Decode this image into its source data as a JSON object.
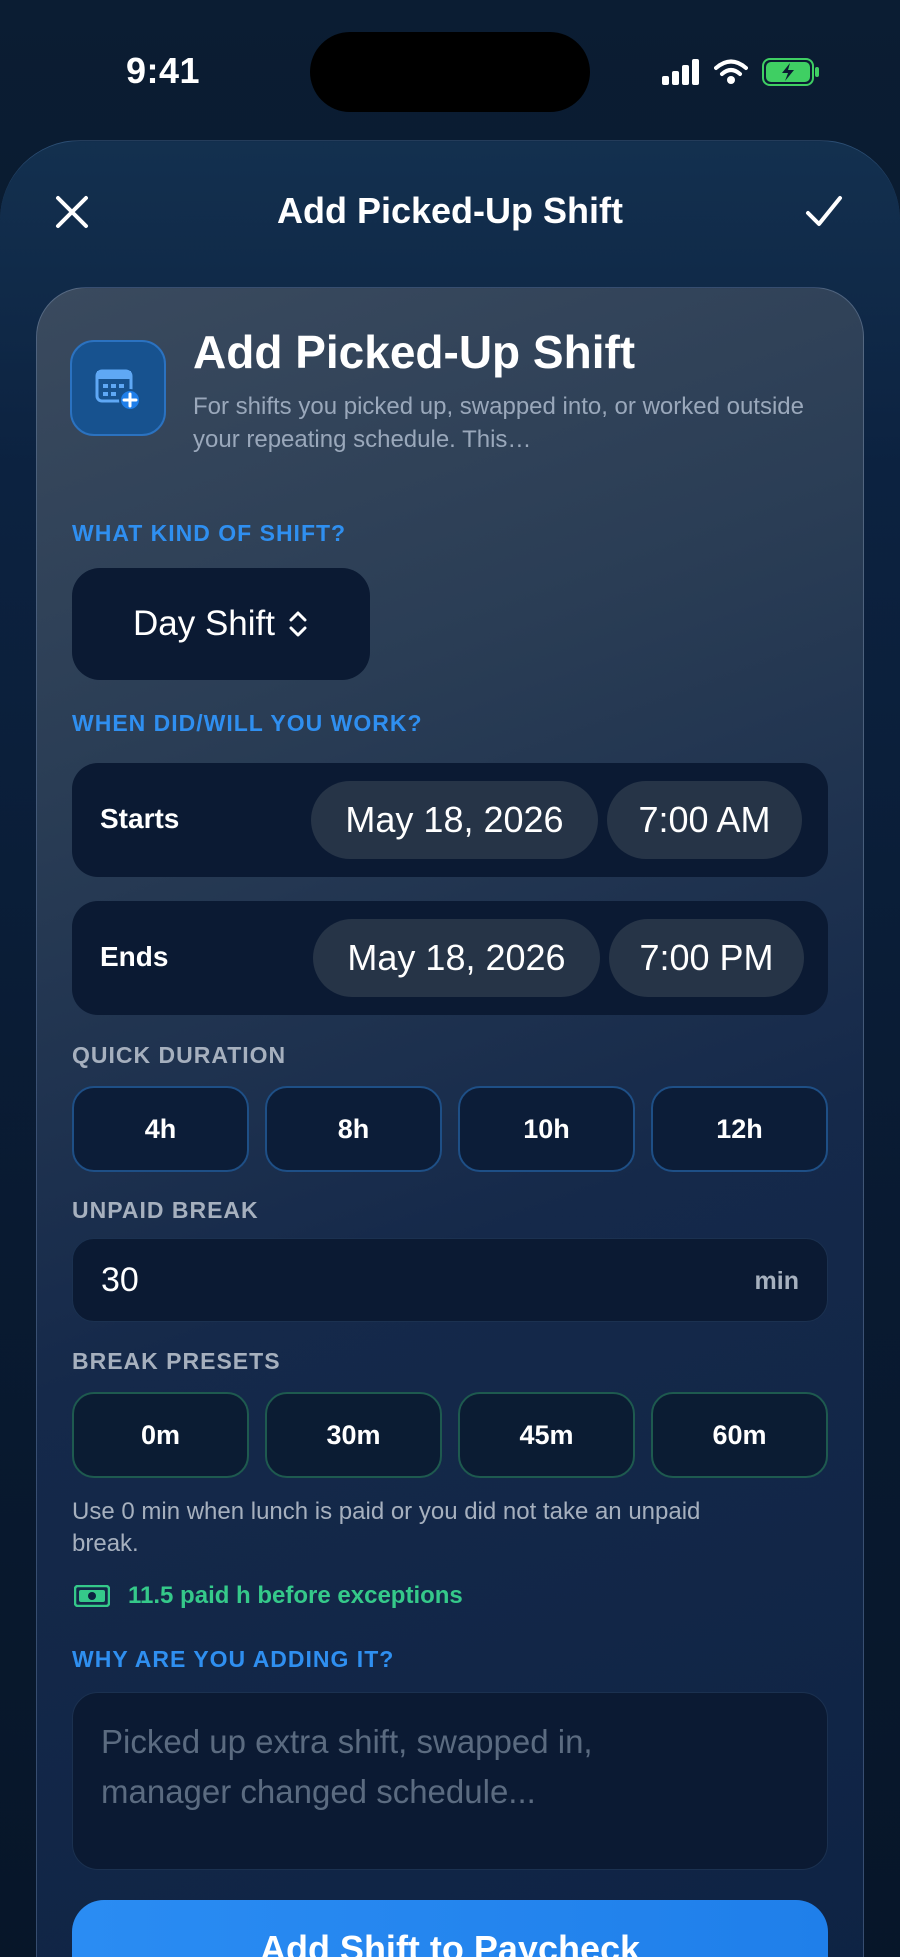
{
  "status_bar": {
    "time": "9:41"
  },
  "nav": {
    "title": "Add Picked-Up Shift"
  },
  "header": {
    "title": "Add Picked-Up Shift",
    "subtitle": "For shifts you picked up, swapped into, or worked outside your repeating schedule. This…"
  },
  "kind": {
    "label": "WHAT KIND OF SHIFT?",
    "value": "Day Shift"
  },
  "when": {
    "label": "WHEN DID/WILL YOU WORK?",
    "rows": [
      {
        "label": "Starts",
        "date": "May 18, 2026",
        "time": "7:00 AM"
      },
      {
        "label": "Ends",
        "date": "May 18, 2026",
        "time": "7:00 PM"
      }
    ]
  },
  "quick_duration": {
    "label": "QUICK DURATION",
    "options": [
      "4h",
      "8h",
      "10h",
      "12h"
    ]
  },
  "unpaid_break": {
    "label": "UNPAID BREAK",
    "value": "30",
    "unit": "min"
  },
  "break_presets": {
    "label": "BREAK PRESETS",
    "options": [
      "0m",
      "30m",
      "45m",
      "60m"
    ]
  },
  "hint": "Use 0 min when lunch is paid or you did not take an unpaid break.",
  "paid_summary": "11.5 paid h before exceptions",
  "reason": {
    "label": "WHY ARE YOU ADDING IT?",
    "placeholder": "Picked up extra shift, swapped in, manager changed schedule..."
  },
  "primary_button": "Add Shift to Paycheck",
  "colors": {
    "accent": "#2f8ff0",
    "success": "#35c98a",
    "background": "#061325"
  }
}
